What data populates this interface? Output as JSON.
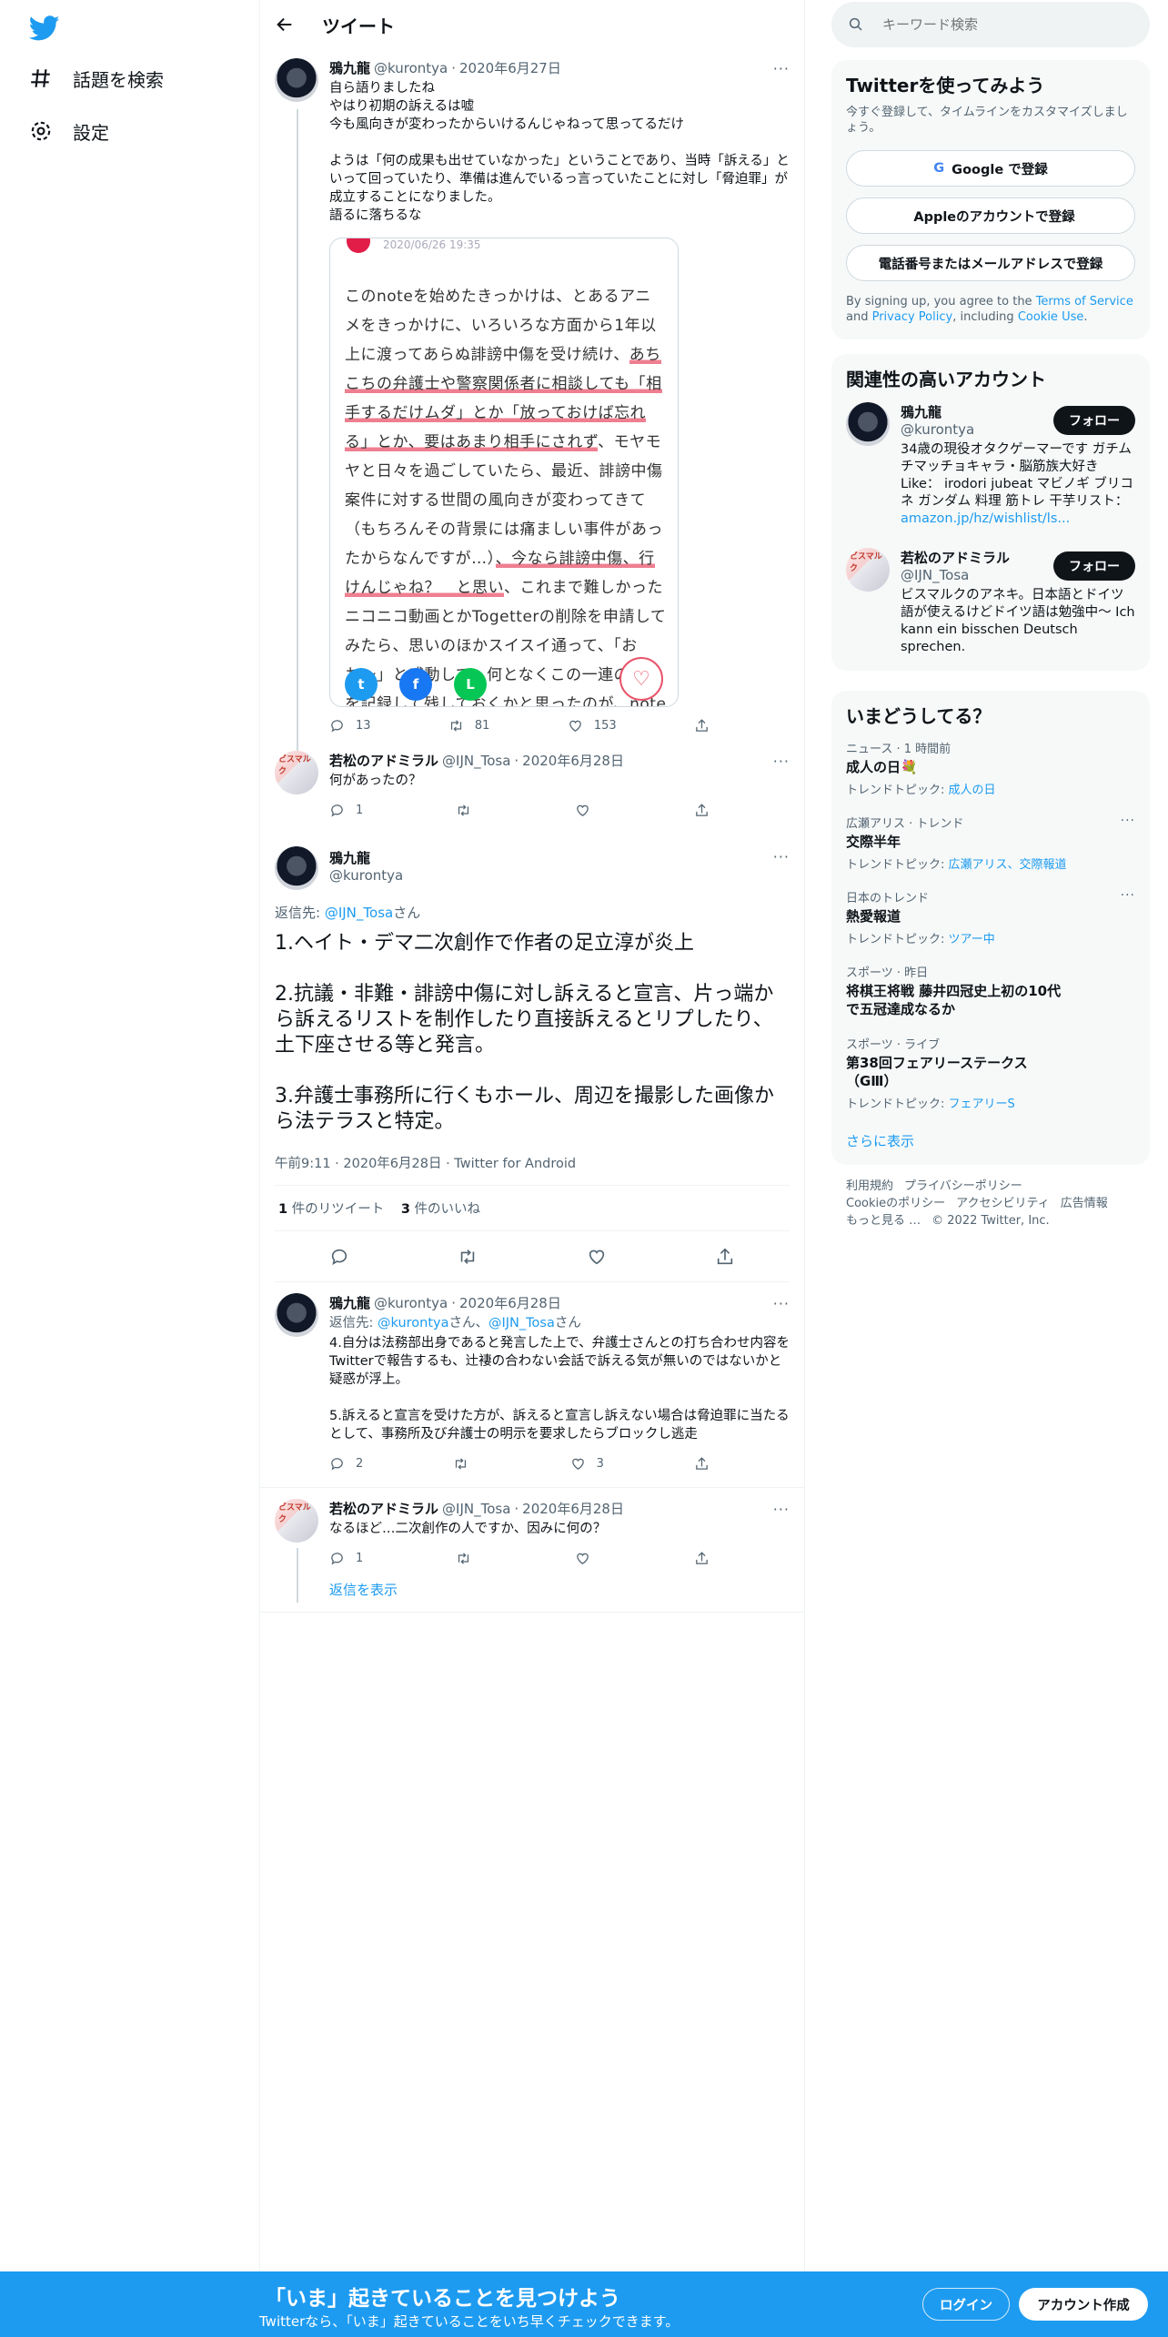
{
  "nav": {
    "explore_label": "話題を検索",
    "settings_label": "設定"
  },
  "header": {
    "title": "ツイート"
  },
  "thread": [
    {
      "name": "鴉九龍",
      "handle": "@kurontya",
      "date": "2020年6月27日",
      "text": "自ら語りましたね\nやはり初期の訴えるは嘘\n今も風向きが変わったからいけるんじゃねって思ってるだけ\n\nようは「何の成果も出せていなかった」ということであり、当時「訴える」といって回っていたり、準備は進んでいるっ言っていたことに対し「脅迫罪」が成立することになりました。\n語るに落ちるな",
      "card": {
        "date": "2020/06/26 19:35",
        "segments": [
          {
            "t": "このnoteを始めたきっかけは、とあるアニメをきっかけに、いろいろな方面から1年以上に渡ってあらぬ誹謗中傷を受け続け、",
            "hl": false
          },
          {
            "t": "あちこちの弁護士や警察関係者に相談しても「相手するだけムダ」とか「放っておけば忘れる」とか、要はあまり相手にされず",
            "hl": true
          },
          {
            "t": "、モヤモヤと日々を過ごしていたら、最近、誹謗中傷案件に対する世間の風向きが変わってきて（もちろんその背景には痛ましい事件があったからなんですが…）",
            "hl": false
          },
          {
            "t": "、今なら誹謗中傷、行けんじゃね？　と思い",
            "hl": true
          },
          {
            "t": "、これまで難しかったニコニコ動画とかTogetterの削除を申請してみたら、思いのほかスイスイ通って、「おお〜」と感動して、何となくこの一連のことを記録して残しておくかと思ったのが、noteを始めたきっかけです。",
            "hl": false
          }
        ]
      },
      "reply_count": "13",
      "retweet_count": "81",
      "like_count": "153"
    },
    {
      "name": "若松のアドミラル",
      "handle": "@IJN_Tosa",
      "date": "2020年6月28日",
      "text": "何があったの？",
      "avatar_badge": "ビスマルク",
      "reply_count": "1",
      "retweet_count": "",
      "like_count": ""
    }
  ],
  "focus": {
    "name": "鴉九龍",
    "handle": "@kurontya",
    "reply_prefix": "返信先: ",
    "reply_to": "@IJN_Tosa",
    "reply_suffix": "さん",
    "paragraphs": [
      "1.ヘイト・デマ二次創作で作者の足立淳が炎上",
      "2.抗議・非難・誹謗中傷に対し訴えると宣言、片っ端から訴えるリストを制作したり直接訴えるとリプしたり、土下座させる等と発言。",
      "3.弁護士事務所に行くもホール、周辺を撮影した画像から法テラスと特定。"
    ],
    "timestamp": "午前9:11 · 2020年6月28日 · Twitter for Android",
    "retweets_num": "1",
    "retweets_label": " 件のリツイート",
    "likes_num": "3",
    "likes_label": " 件のいいね"
  },
  "replies": [
    {
      "name": "鴉九龍",
      "handle": "@kurontya",
      "date": "2020年6月28日",
      "reply_prefix": "返信先: ",
      "reply_to_1": "@kurontya",
      "reply_mid": "さん、",
      "reply_to_2": "@IJN_Tosa",
      "reply_suffix": "さん",
      "text": "4.自分は法務部出身であると発言した上で、弁護士さんとの打ち合わせ内容をTwitterで報告するも、辻褄の合わない会話で訴える気が無いのではないかと疑惑が浮上。\n\n5.訴えると宣言を受けた方が、訴えると宣言し訴えない場合は脅迫罪に当たるとして、事務所及び弁護士の明示を要求したらブロックし逃走",
      "reply_count": "2",
      "retweet_count": "",
      "like_count": "3"
    },
    {
      "name": "若松のアドミラル",
      "handle": "@IJN_Tosa",
      "date": "2020年6月28日",
      "text": "なるほど…二次創作の人ですか、因みに何の？",
      "reply_count": "1",
      "retweet_count": "",
      "like_count": ""
    }
  ],
  "show_replies": "返信を表示",
  "search": {
    "placeholder": "キーワード検索"
  },
  "signup_panel": {
    "title": "Twitterを使ってみよう",
    "subtitle": "今すぐ登録して、タイムラインをカスタマイズしましょう。",
    "google": "Google で登録",
    "google_icon": "G",
    "apple": "Appleのアカウントで登録",
    "apple_icon": "",
    "phone": "電話番号またはメールアドレスで登録",
    "tos_1": "By signing up, you agree to the ",
    "tos_link1": "Terms of Service",
    "tos_2": " and ",
    "tos_link2": "Privacy Policy",
    "tos_3": ", including ",
    "tos_link3": "Cookie Use",
    "tos_4": "."
  },
  "related": {
    "title": "関連性の高いアカウント",
    "accounts": [
      {
        "name": "鴉九龍",
        "handle": "@kurontya",
        "bio": "34歳の現役オタクゲーマーです ガチムチマッチョキャラ・脳筋族大好き Like： irodori jubeat マビノギ ブリコネ ガンダム 料理 筋トレ 干芋リスト： ",
        "link": "amazon.jp/hz/wishlist/ls...",
        "follow": "フォロー"
      },
      {
        "name": "若松のアドミラル",
        "handle": "@IJN_Tosa",
        "bio": "ビスマルクのアネキ。日本語とドイツ語が使えるけどドイツ語は勉強中〜 Ich kann ein bisschen Deutsch sprechen.",
        "link": "",
        "follow": "フォロー"
      }
    ]
  },
  "trends": {
    "title": "いまどうしてる？",
    "items": [
      {
        "cat": "ニュース · 1 時間前",
        "title": "成人の日💐",
        "tp_label": "トレンドトピック: ",
        "tp": "成人の日",
        "more": false
      },
      {
        "cat": "広瀬アリス · トレンド",
        "title": "交際半年",
        "tp_label": "トレンドトピック: ",
        "tp": "広瀬アリス、交際報道",
        "more": true
      },
      {
        "cat": "日本のトレンド",
        "title": "熱愛報道",
        "tp_label": "トレンドトピック: ",
        "tp": "ツアー中",
        "more": true
      },
      {
        "cat": "スポーツ · 昨日",
        "title": "将棋王将戦 藤井四冠史上初の10代で五冠達成なるか",
        "tp_label": "",
        "tp": "",
        "more": false
      },
      {
        "cat": "スポーツ · ライブ",
        "title": "第38回フェアリーステークス（GⅢ）",
        "tp_label": "トレンドトピック: ",
        "tp": "フェアリーS",
        "more": false
      }
    ],
    "show_more": "さらに表示"
  },
  "footer": {
    "l1a": "利用規約",
    "l1b": "プライバシーポリシー",
    "l2a": "Cookieのポリシー",
    "l2b": "アクセシビリティ",
    "l2c": "広告情報",
    "l3a": "もっと見る …",
    "l3b": "© 2022 Twitter, Inc."
  },
  "bottombar": {
    "title": "「いま」起きていることを見つけよう",
    "subtitle": "Twitterなら、「いま」起きていることをいち早くチェックできます。",
    "login": "ログイン",
    "signup": "アカウント作成"
  },
  "colors": {
    "accent": "#1d9bf0",
    "text": "#0f1419",
    "muted": "#536471",
    "highlight": "#e9546b"
  }
}
